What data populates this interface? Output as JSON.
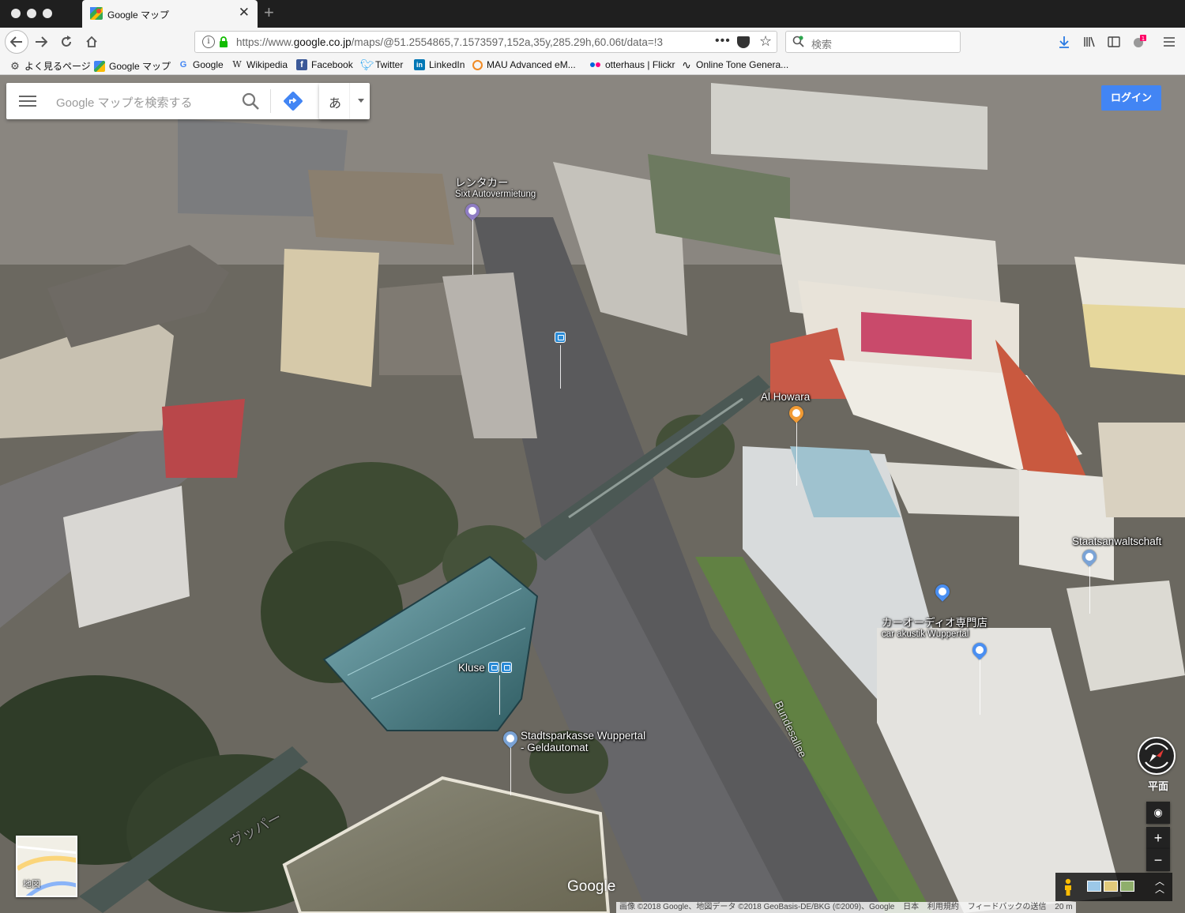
{
  "browser": {
    "tab_title": "Google マップ",
    "url_prefix": "https://www.",
    "url_domain": "google.co.jp",
    "url_rest": "/maps/@51.2554865,7.1573597,152a,35y,285.29h,60.06t/data=!3",
    "search_placeholder": "検索",
    "notification_count": "1"
  },
  "bookmarks": [
    {
      "label": "よく見るページ",
      "icon": "gear-icon"
    },
    {
      "label": "Google マップ",
      "icon": "google-maps-icon"
    },
    {
      "label": "Google",
      "icon": "google-icon"
    },
    {
      "label": "Wikipedia",
      "icon": "wikipedia-icon"
    },
    {
      "label": "Facebook",
      "icon": "facebook-icon"
    },
    {
      "label": "Twitter",
      "icon": "twitter-icon"
    },
    {
      "label": "LinkedIn",
      "icon": "linkedin-icon"
    },
    {
      "label": "MAU Advanced eM...",
      "icon": "circle-icon"
    },
    {
      "label": "otterhaus | Flickr",
      "icon": "flickr-icon"
    },
    {
      "label": "Online Tone Genera...",
      "icon": "wave-icon"
    }
  ],
  "maps": {
    "search_placeholder": "Google マップを検索する",
    "ime_label": "あ",
    "login_label": "ログイン",
    "tilt_label": "平面",
    "minimap_label": "地図",
    "google_logo": "Google",
    "zoom_in": "+",
    "zoom_out": "−"
  },
  "pois": {
    "rental": {
      "name": "レンタカー",
      "sub": "Sixt Autovermietung",
      "color": "#8e7cc3"
    },
    "al_howara": {
      "name": "Al Howara",
      "color": "#f29b34"
    },
    "staatsanwaltschaft": {
      "name": "Staatsanwaltschaft",
      "color": "#7aa3d6"
    },
    "car_audio": {
      "name": "カーオーディオ専門店",
      "sub": "car akustik Wuppertal",
      "color": "#4a8ff2"
    },
    "kluse": {
      "name": "Kluse"
    },
    "sparkasse": {
      "name": "Stadtsparkasse Wuppertal",
      "sub": "- Geldautomat",
      "color": "#7aa3d6"
    }
  },
  "streets": {
    "bundesallee": "Bundesallee",
    "wupper": "ヴッパー"
  },
  "footer": [
    "画像 ©2018 Google、地図データ ©2018 GeoBasis-DE/BKG (©2009)、Google",
    "日本",
    "利用規約",
    "フィードバックの送信",
    "20 m"
  ],
  "colors": {
    "brand_blue": "#4285f4",
    "chrome_bg": "#f5f5f5",
    "titlebar": "#1f1f1f"
  }
}
